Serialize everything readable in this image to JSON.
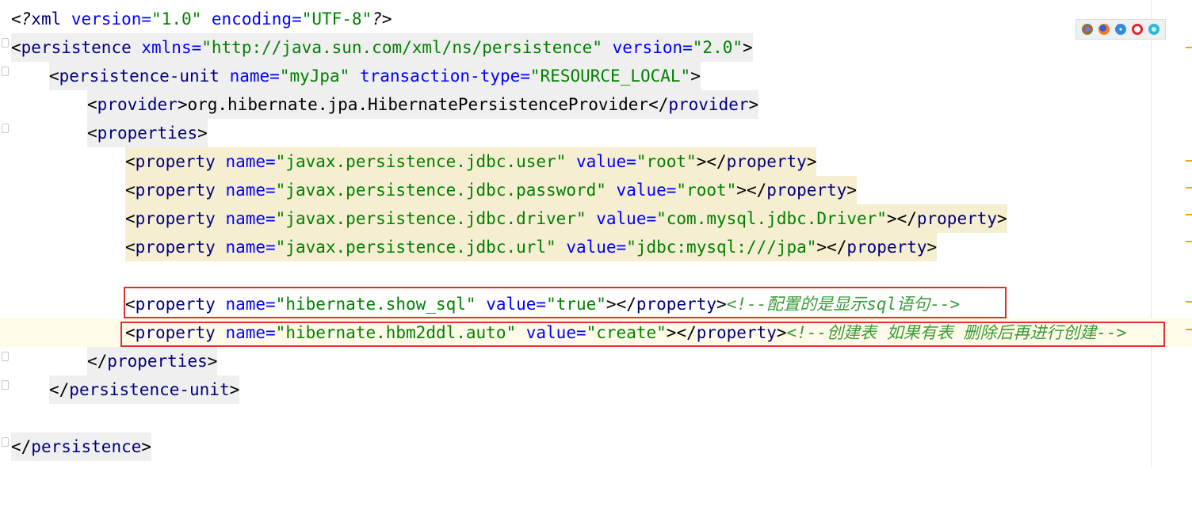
{
  "browsers": [
    "chrome-icon",
    "firefox-icon",
    "safari-icon",
    "opera-icon",
    "ie-icon"
  ],
  "colors": {
    "tag": "#000080",
    "attr": "#0000ff",
    "value": "#008000",
    "highlight_box": "#e03030"
  },
  "lines": {
    "l1": {
      "open": "<?",
      "tag": "xml",
      "attr1": " version=",
      "val1": "\"1.0\"",
      "attr2": " encoding=",
      "val2": "\"UTF-8\"",
      "close": "?>"
    },
    "l2": {
      "open": "<",
      "tag": "persistence",
      "attr1": " xmlns=",
      "val1": "\"http://java.sun.com/xml/ns/persistence\"",
      "attr2": " version=",
      "val2": "\"2.0\"",
      "close": ">"
    },
    "l3": {
      "open": "<",
      "tag": "persistence-unit",
      "attr1": " name=",
      "val1": "\"myJpa\"",
      "attr2": " transaction-type=",
      "val2": "\"RESOURCE_LOCAL\"",
      "close": ">"
    },
    "l4": {
      "open": "<",
      "tag": "provider",
      "close": ">",
      "text": "org.hibernate.jpa.HibernatePersistenceProvider",
      "open2": "</",
      "tag2": "provider",
      "close2": ">"
    },
    "l5": {
      "open": "<",
      "tag": "properties",
      "close": ">"
    },
    "l6": {
      "open": "<",
      "tag": "property",
      "attr1": " name=",
      "val1": "\"javax.persistence.jdbc.user\"",
      "attr2": " value=",
      "val2": "\"root\"",
      "close": ">",
      "open2": "</",
      "tag2": "property",
      "close2": ">"
    },
    "l7": {
      "open": "<",
      "tag": "property",
      "attr1": " name=",
      "val1": "\"javax.persistence.jdbc.password\"",
      "attr2": " value=",
      "val2": "\"root\"",
      "close": ">",
      "open2": "</",
      "tag2": "property",
      "close2": ">"
    },
    "l8": {
      "open": "<",
      "tag": "property",
      "attr1": " name=",
      "val1": "\"javax.persistence.jdbc.driver\"",
      "attr2": " value=",
      "val2": "\"com.mysql.jdbc.Driver\"",
      "close": ">",
      "open2": "</",
      "tag2": "property",
      "close2": ">"
    },
    "l9": {
      "open": "<",
      "tag": "property",
      "attr1": " name=",
      "val1": "\"javax.persistence.jdbc.url\"",
      "attr2": " value=",
      "val2": "\"jdbc:mysql:///jpa\"",
      "close": ">",
      "open2": "</",
      "tag2": "property",
      "close2": ">"
    },
    "l11": {
      "open": "<",
      "tag": "property",
      "attr1": " name=",
      "val1": "\"hibernate.show_sql\"",
      "attr2": " value=",
      "val2": "\"true\"",
      "close": ">",
      "open2": "</",
      "tag2": "property",
      "close2": ">",
      "comment": "<!--配置的是显示sql语句-->"
    },
    "l12": {
      "open": "<",
      "tag": "property",
      "attr1": " name=",
      "val1": "\"hibernate.hbm2ddl.auto\"",
      "attr2": " value=",
      "val2": "\"create\"",
      "close": ">",
      "open2": "</",
      "tag2": "property",
      "close2": ">",
      "comment": "<!--创建表 如果有表 删除后再进行创建-->"
    },
    "l13": {
      "open": "</",
      "tag": "properties",
      "close": ">"
    },
    "l14": {
      "open": "</",
      "tag": "persistence-unit",
      "close": ">"
    },
    "l16": {
      "open": "</",
      "tag": "persistence",
      "close": ">"
    }
  }
}
